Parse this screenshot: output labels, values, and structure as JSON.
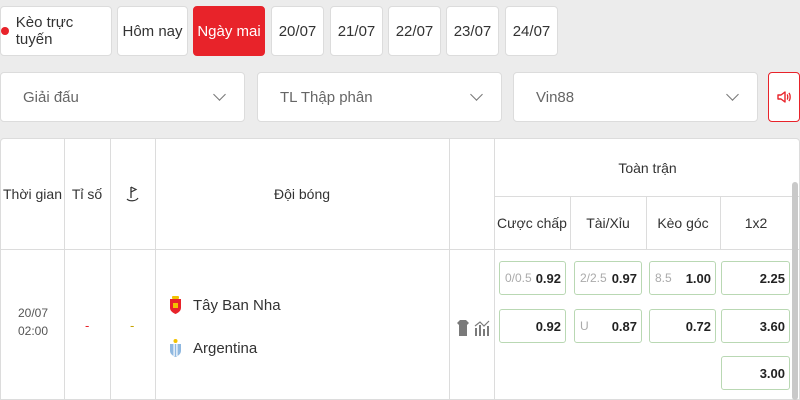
{
  "tabs": {
    "live_label": "Kèo trực tuyến",
    "today_label": "Hôm nay",
    "tomorrow_label": "Ngày mai",
    "dates": [
      "20/07",
      "21/07",
      "22/07",
      "23/07",
      "24/07"
    ]
  },
  "filters": {
    "league": "Giải đấu",
    "odds_format": "TL Thập phân",
    "bookmaker": "Vin88"
  },
  "table": {
    "headers": {
      "time": "Thời gian",
      "score": "Tỉ số",
      "teams": "Đội bóng",
      "full_match": "Toàn trận",
      "handicap": "Cược chấp",
      "over_under": "Tài/Xỉu",
      "corners": "Kèo góc",
      "one_x_two": "1x2"
    },
    "match": {
      "date": "20/07",
      "time": "02:00",
      "score": "-",
      "corner_count": "-",
      "home_team": "Tây Ban Nha",
      "away_team": "Argentina",
      "handicap": [
        {
          "line": "0/0.5",
          "price": "0.92"
        },
        {
          "line": "",
          "price": "0.92"
        }
      ],
      "over_under": [
        {
          "line": "2/2.5",
          "price": "0.97"
        },
        {
          "line": "U",
          "price": "0.87"
        }
      ],
      "corners": [
        {
          "line": "8.5",
          "price": "1.00"
        },
        {
          "line": "",
          "price": "0.72"
        }
      ],
      "one_x_two": [
        "2.25",
        "3.60",
        "3.00"
      ]
    }
  },
  "colors": {
    "accent": "#e8232a",
    "odds_border": "#b9d8b3"
  }
}
